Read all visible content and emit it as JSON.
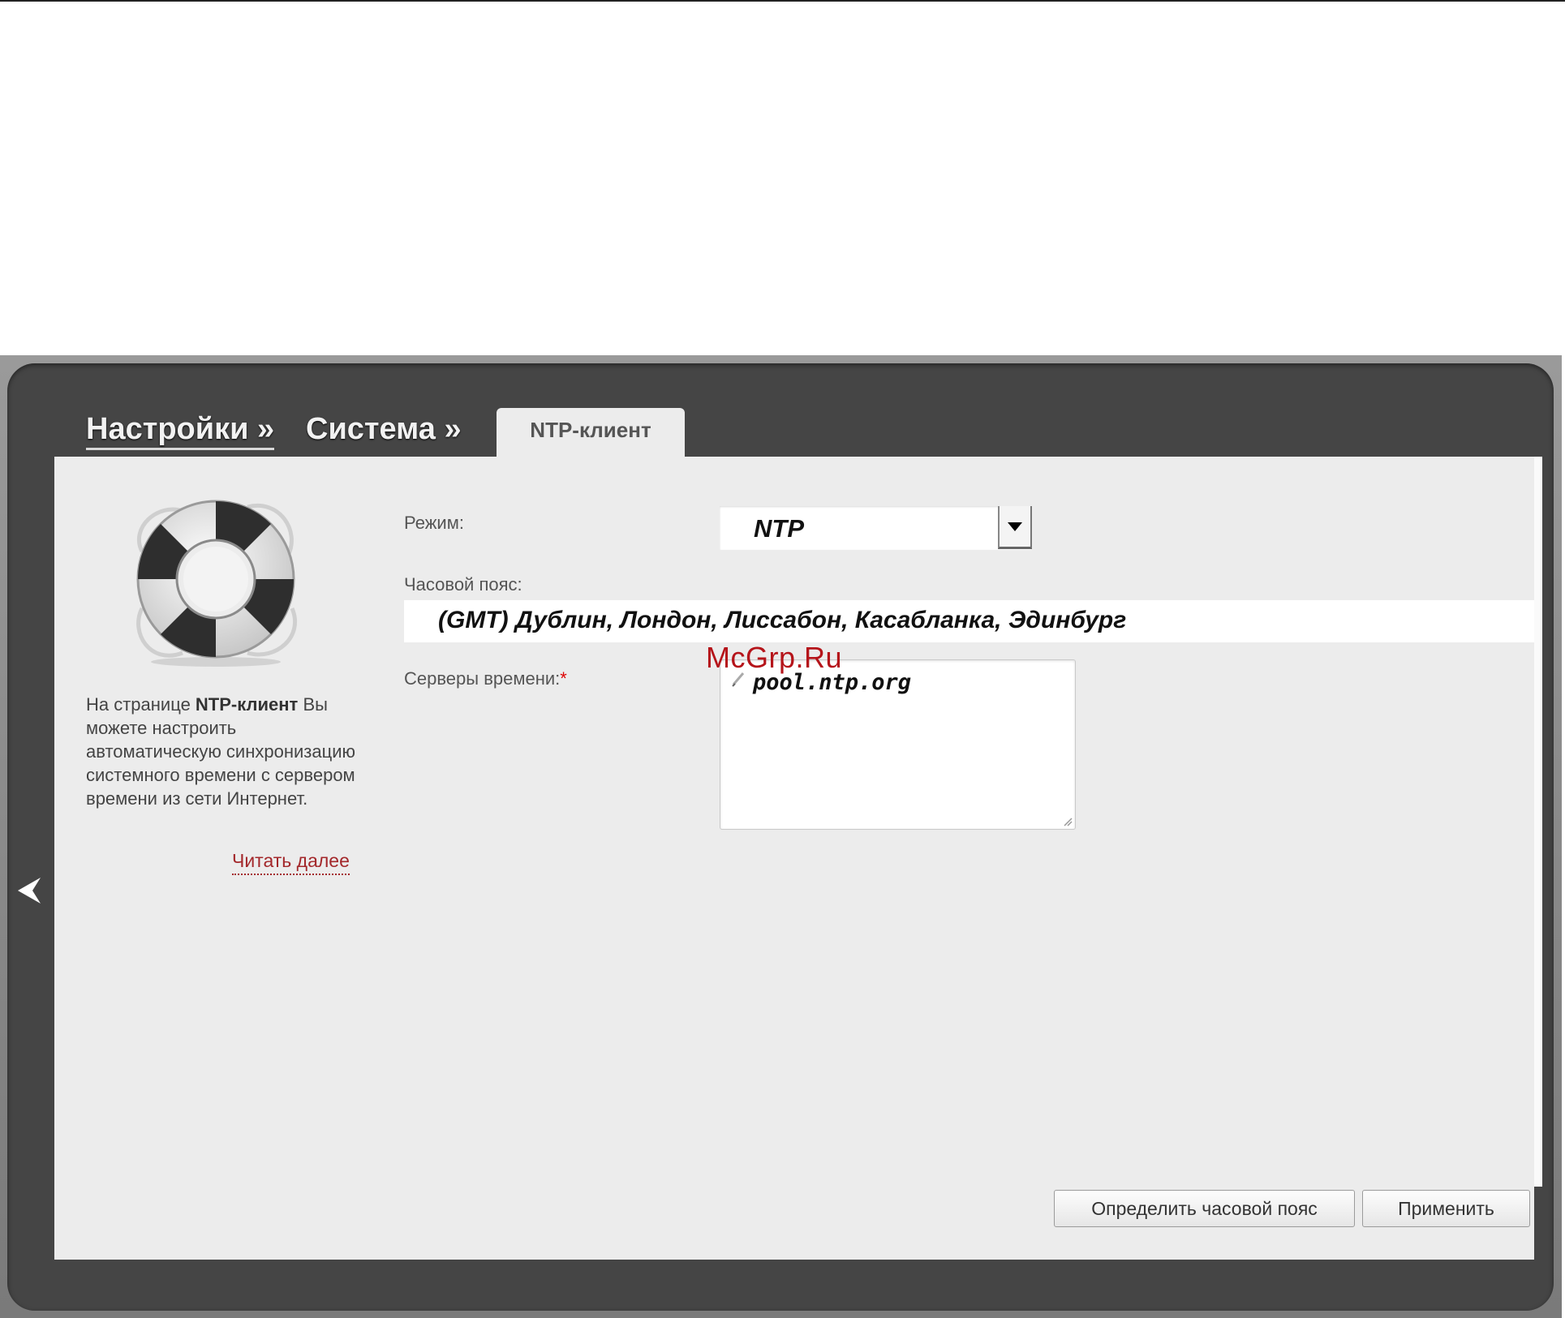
{
  "breadcrumb": {
    "settings": "Настройки »",
    "system": "Система »",
    "active_tab": "NTP-клиент"
  },
  "sidebar": {
    "help_prefix": "На странице ",
    "help_bold": "NTP-клиент",
    "help_suffix": " Вы можете настроить автоматическую синхронизацию системного времени с сервером времени из сети Интернет.",
    "read_more": "Читать далее"
  },
  "form": {
    "mode_label": "Режим:",
    "mode_value": "NTP",
    "timezone_label": "Часовой пояс:",
    "timezone_value": "(GMT) Дублин, Лондон, Лиссабон, Касабланка, Эдинбург",
    "servers_label": "Серверы времени:",
    "servers_required": "*",
    "servers_value": "pool.ntp.org"
  },
  "watermark": "McGrp.Ru",
  "buttons": {
    "detect_timezone": "Определить часовой пояс",
    "apply": "Применить"
  },
  "colors": {
    "outer_frame": "#454545",
    "panel": "#ececec",
    "link": "#a3282b",
    "watermark": "#b5141a"
  }
}
